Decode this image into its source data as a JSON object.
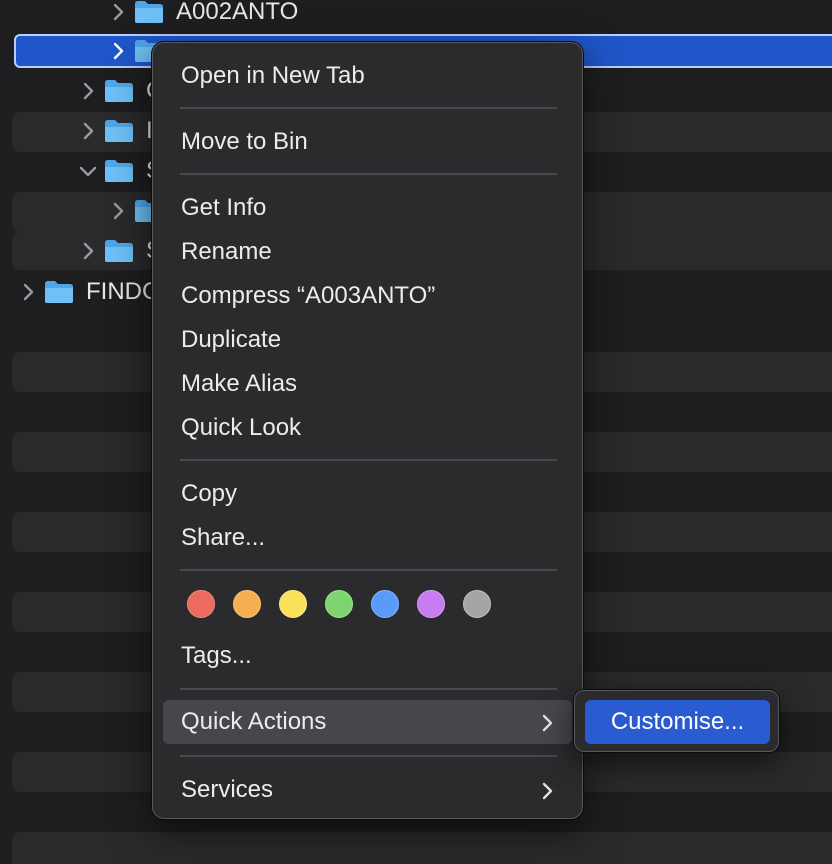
{
  "finder": {
    "rows": [
      {
        "label": "A002ANTO",
        "chevron": "right"
      },
      {
        "label": "",
        "chevron": "right",
        "selected": true
      },
      {
        "label": "C",
        "chevron": "right"
      },
      {
        "label": "I",
        "chevron": "right"
      },
      {
        "label": "S",
        "chevron": "down"
      },
      {
        "label": "",
        "chevron": "right"
      },
      {
        "label": "S",
        "chevron": "right"
      },
      {
        "label": "FINDC",
        "chevron": "right"
      }
    ]
  },
  "context_menu": {
    "open_new_tab": "Open in New Tab",
    "move_to_bin": "Move to Bin",
    "get_info": "Get Info",
    "rename": "Rename",
    "compress": "Compress “A003ANTO”",
    "duplicate": "Duplicate",
    "make_alias": "Make Alias",
    "quick_look": "Quick Look",
    "copy": "Copy",
    "share": "Share...",
    "tags": "Tags...",
    "quick_actions": "Quick Actions",
    "services": "Services",
    "tag_colors": [
      "#ec6a5e",
      "#f4b04f",
      "#fbe15a",
      "#7ed56f",
      "#5b9bf8",
      "#c77df0",
      "#a5a5a8"
    ],
    "tag_names": [
      "red",
      "orange",
      "yellow",
      "green",
      "blue",
      "purple",
      "gray"
    ]
  },
  "submenu": {
    "customise": "Customise..."
  },
  "colors": {
    "selection": "#1f56c9",
    "submenu_highlight": "#2a5bd0",
    "folder": "#5fb3f0"
  }
}
